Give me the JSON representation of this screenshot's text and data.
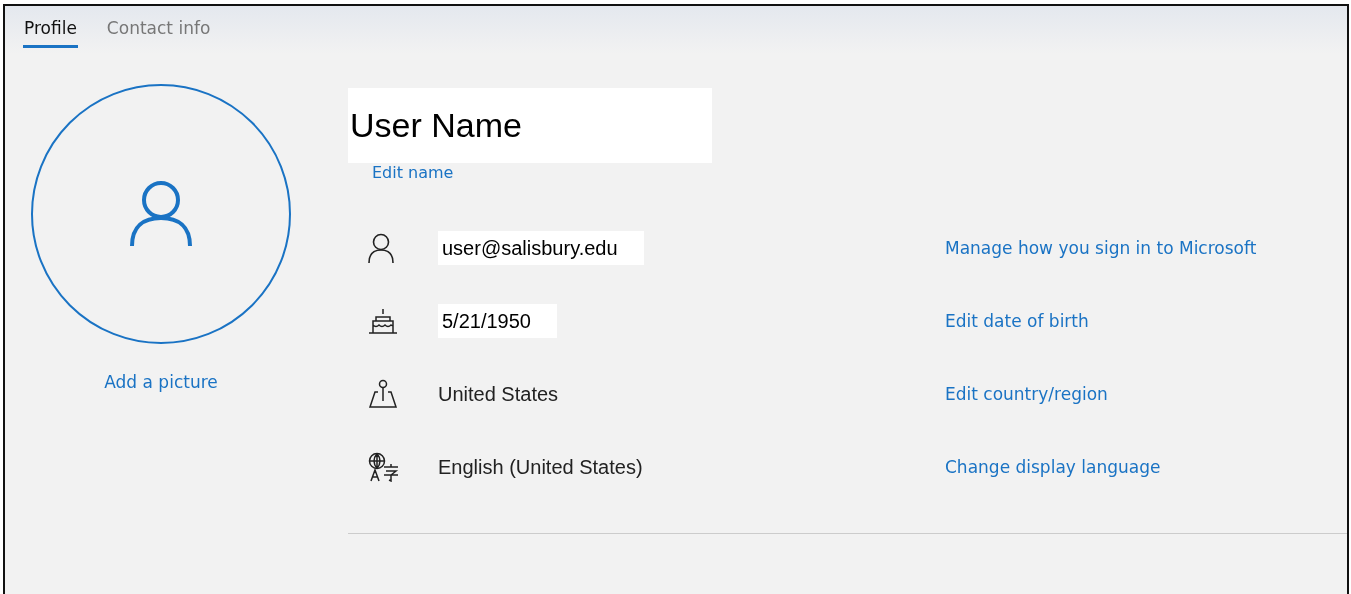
{
  "tabs": [
    {
      "label": "Profile",
      "selected": true
    },
    {
      "label": "Contact info",
      "selected": false
    }
  ],
  "picture": {
    "link": "Add a picture"
  },
  "name": {
    "value": "User Name",
    "highlighted": true,
    "link": "Edit name"
  },
  "rows": [
    {
      "kind": "account",
      "value": "user@salisbury.edu",
      "highlighted": true,
      "link": "Manage how you sign in to Microsoft"
    },
    {
      "kind": "birthday",
      "value": "5/21/1950",
      "highlighted": true,
      "link": "Edit date of birth"
    },
    {
      "kind": "location",
      "value": "United States",
      "highlighted": false,
      "link": "Edit country/region"
    },
    {
      "kind": "language",
      "value": "English (United States)",
      "highlighted": false,
      "link": "Change display language"
    }
  ]
}
